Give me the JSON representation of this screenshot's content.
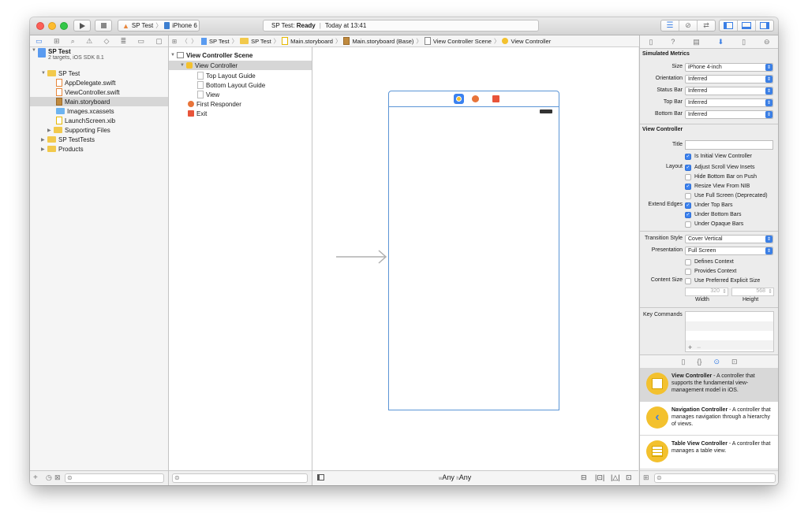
{
  "toolbar": {
    "scheme_target": "SP Test",
    "scheme_device": "iPhone 6",
    "activity_project": "SP Test:",
    "activity_status": "Ready",
    "activity_time": "Today at 13:41"
  },
  "navigator": {
    "project_name": "SP Test",
    "project_sub": "2 targets, iOS SDK 8.1",
    "group": "SP Test",
    "files": [
      "AppDelegate.swift",
      "ViewController.swift",
      "Main.storyboard",
      "Images.xcassets",
      "LaunchScreen.xib"
    ],
    "supporting": "Supporting Files",
    "tests": "SP TestTests",
    "products": "Products"
  },
  "jumpbar": [
    "SP Test",
    "SP Test",
    "Main.storyboard",
    "Main.storyboard (Base)",
    "View Controller Scene",
    "View Controller"
  ],
  "outline": {
    "scene": "View Controller Scene",
    "vc": "View Controller",
    "top_guide": "Top Layout Guide",
    "bottom_guide": "Bottom Layout Guide",
    "view": "View",
    "responder": "First Responder",
    "exit": "Exit"
  },
  "canvas": {
    "size_w_prefix": "w",
    "size_w": "Any",
    "size_h_prefix": "h",
    "size_h": "Any"
  },
  "inspector": {
    "simulated_metrics": "Simulated Metrics",
    "size_label": "Size",
    "size_value": "iPhone 4-inch",
    "orientation_label": "Orientation",
    "orientation_value": "Inferred",
    "status_label": "Status Bar",
    "status_value": "Inferred",
    "topbar_label": "Top Bar",
    "topbar_value": "Inferred",
    "bottombar_label": "Bottom Bar",
    "bottombar_value": "Inferred",
    "vc_header": "View Controller",
    "title_label": "Title",
    "initial_vc": "Is Initial View Controller",
    "layout_label": "Layout",
    "adjust_scroll": "Adjust Scroll View Insets",
    "hide_bottom": "Hide Bottom Bar on Push",
    "resize_nib": "Resize View From NIB",
    "full_screen": "Use Full Screen (Deprecated)",
    "extend_label": "Extend Edges",
    "under_top": "Under Top Bars",
    "under_bottom": "Under Bottom Bars",
    "under_opaque": "Under Opaque Bars",
    "transition_label": "Transition Style",
    "transition_value": "Cover Vertical",
    "presentation_label": "Presentation",
    "presentation_value": "Full Screen",
    "defines_context": "Defines Context",
    "provides_context": "Provides Context",
    "content_size_label": "Content Size",
    "preferred_size": "Use Preferred Explicit Size",
    "width_value": "320",
    "height_value": "568",
    "width_label": "Width",
    "height_label": "Height",
    "key_commands": "Key Commands"
  },
  "library": [
    {
      "title": "View Controller",
      "desc": " - A controller that supports the fundamental view-management model in iOS."
    },
    {
      "title": "Navigation Controller",
      "desc": " - A controller that manages navigation through a hierarchy of views."
    },
    {
      "title": "Table View Controller",
      "desc": " - A controller that manages a table view."
    }
  ]
}
